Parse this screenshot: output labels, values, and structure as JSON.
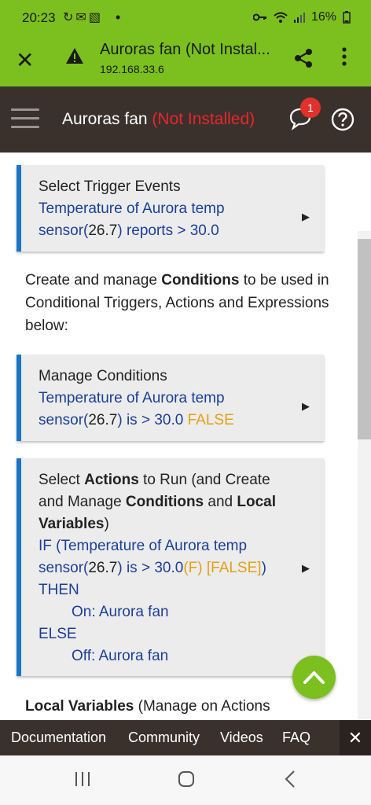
{
  "status": {
    "time": "20:23",
    "left_icons": "↻✉▧",
    "dot": "•",
    "battery": "16%"
  },
  "browser": {
    "title": "Auroras fan (Not Instal...",
    "url": "192.168.33.6"
  },
  "app": {
    "title": "Auroras fan",
    "status": "(Not Installed)",
    "notifications": "1"
  },
  "trigger_card": {
    "heading": "Select Trigger Events",
    "line1": "Temperature of Aurora temp",
    "line2_prefix": "sensor(",
    "line2_value": "26.7",
    "line2_suffix": ") reports > 30.0"
  },
  "conditions_intro": {
    "part1": "Create and manage ",
    "bold": "Conditions",
    "part2": " to be used in Conditional Triggers, Actions and Expressions below:"
  },
  "conditions_card": {
    "heading": "Manage Conditions",
    "line1": "Temperature of Aurora temp",
    "line2_prefix": "sensor(",
    "line2_value": "26.7",
    "line2_suffix": ") is > 30.0 ",
    "state": "FALSE"
  },
  "actions_card": {
    "h1": "Select ",
    "h1_bold": "Actions",
    "h2": " to Run (and Create and Manage ",
    "h2_bold": "Conditions",
    "h3": " and ",
    "h3_bold": "Local Variables",
    "h4": ")",
    "if_line1": "IF (Temperature of Aurora temp",
    "if_line2_prefix": "sensor(",
    "if_line2_value": "26.7",
    "if_line2_mid": ") is > 30.0",
    "if_line2_f": "(F)",
    "if_line2_state": " [FALSE]",
    "if_line2_end": ")",
    "then": "THEN",
    "on_action": "On: Aurora fan",
    "else": "ELSE",
    "off_action": "Off: Aurora fan"
  },
  "local_vars": {
    "bold": "Local Variables",
    "rest": " (Manage on Actions"
  },
  "footer": {
    "documentation": "Documentation",
    "community": "Community",
    "videos": "Videos",
    "faq": "FAQ",
    "close": "✕"
  },
  "colors": {
    "brand_green": "#7bc01f",
    "header_dark": "#3a312d",
    "accent_blue": "#1a75c5",
    "text_blue": "#1c3f95",
    "state_orange": "#e2a117",
    "error_red": "#e8262a"
  }
}
